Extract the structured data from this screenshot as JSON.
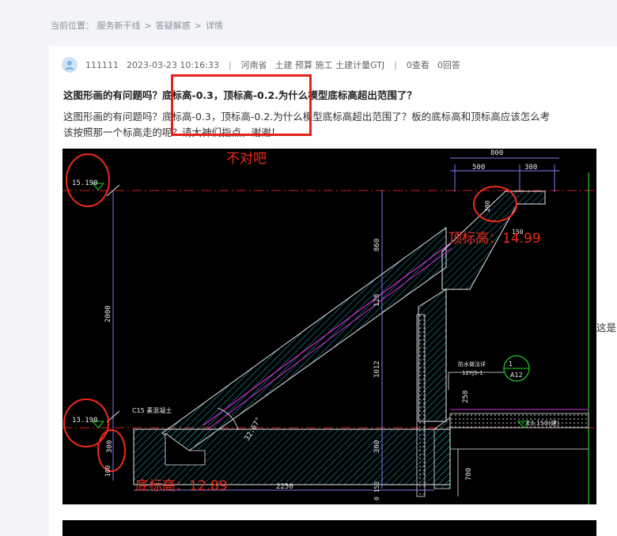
{
  "breadcrumb": {
    "label": "当前位置：",
    "items": [
      "服务新干线",
      "答疑解惑",
      "详情"
    ],
    "separator": ">"
  },
  "post": {
    "user": "111111",
    "datetime": "2023-03-23 10:16:33",
    "region": "河南省",
    "tags": "土建 预算 施工 土建计量GTJ",
    "views": "0查看",
    "answers": "0回答",
    "title": "这图形画的有问题吗？底标高-0.3，顶标高-0.2.为什么模型底标高超出范围了？",
    "body_line1": "这图形画的有问题吗？底标高-0.3，顶标高-0.2.为什么模型底标高超出范围了？板的底标高和顶标高应该怎么考",
    "body_line2": "该按照那一个标高走的呢？请大神们指点，谢谢！",
    "side_text": "这是"
  },
  "drawing": {
    "annotations": {
      "wrong": "不对吧",
      "top_elev": "顶标高：14.99",
      "bottom_elev": "底标高：12.89"
    },
    "labels": {
      "elev_top": "15.190",
      "elev_bottom": "13.190",
      "dim_800": "800",
      "dim_500": "500",
      "dim_300": "300",
      "dim_200": "200",
      "dim_150": "150",
      "dim_860": "860",
      "dim_128": "128",
      "dim_2000": "2000",
      "dim_1012": "1012",
      "dim_250": "250",
      "dim_2250": "2250",
      "dim_100": "100",
      "dim_700": "700",
      "dim_300b": "300",
      "dim_300c": "300",
      "dim_150b": "0 150",
      "dim_300d": "300",
      "angle": "32.67°",
      "concrete": "C15 素混凝土",
      "detail": "A12",
      "detail_num": "1",
      "detail_ref": "12YJ5-1",
      "detail_note": "防水做法详",
      "elev_right": "13.150(建)"
    },
    "colors": {
      "background": "#000000",
      "hatch": "#19b3c6",
      "magenta": "#d42ad6",
      "white": "#e8e8e8",
      "red_annotation": "#f02a1a",
      "green": "#1fd01f",
      "dim_blue": "#7d7df0"
    }
  }
}
